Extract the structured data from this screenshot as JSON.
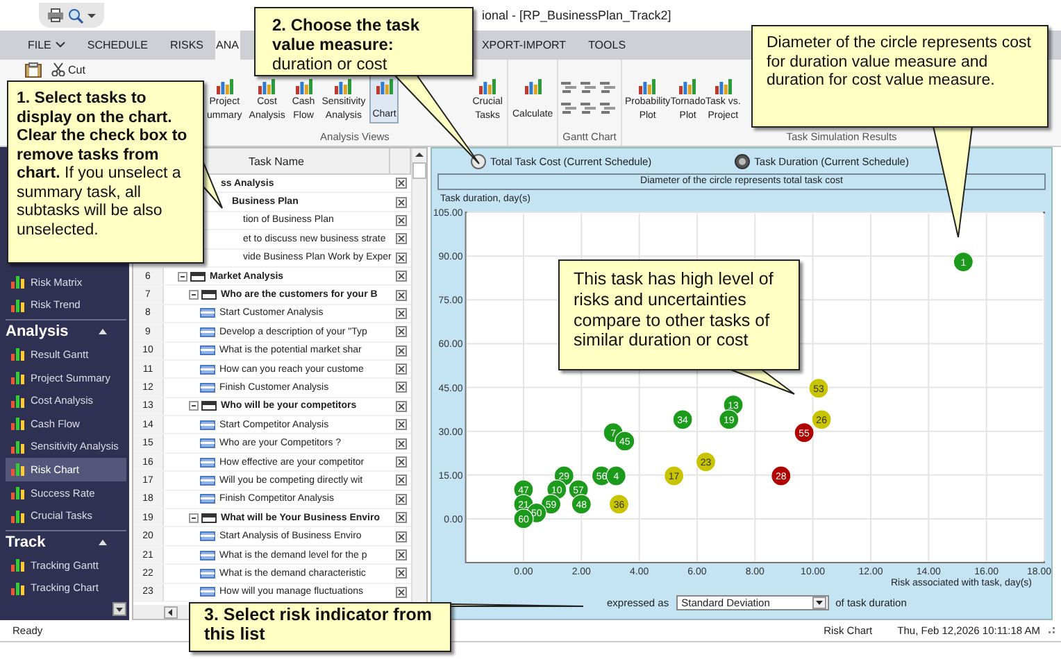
{
  "title_bar": {
    "title": "ional - [RP_BusinessPlan_Track2]"
  },
  "tabs": [
    {
      "label": "FILE",
      "kind": "menu",
      "selected": false
    },
    {
      "label": "SCHEDULE",
      "kind": "tab",
      "selected": false
    },
    {
      "label": "RISKS",
      "kind": "tab",
      "selected": false
    },
    {
      "label": "ANA",
      "kind": "tab",
      "selected": true
    },
    {
      "label": "XPORT-IMPORT",
      "kind": "tab",
      "selected": false
    },
    {
      "label": "TOOLS",
      "kind": "tab",
      "selected": false
    }
  ],
  "ribbon": {
    "clipboard": {
      "cut": "Cut"
    },
    "groups": [
      {
        "label": "Analysis Views",
        "kind": "large",
        "buttons": [
          {
            "lines": [
              "Project",
              "ummary"
            ],
            "selected": false
          },
          {
            "lines": [
              "Cost",
              "Analysis"
            ],
            "selected": false
          },
          {
            "lines": [
              "Cash",
              "Flow"
            ],
            "selected": false
          },
          {
            "lines": [
              "Sensitivity",
              "Analysis"
            ],
            "selected": false
          },
          {
            "lines": [
              "Chart"
            ],
            "selected": true
          },
          {
            "lines": [
              "Crucial",
              "Tasks"
            ],
            "selected": false
          }
        ]
      },
      {
        "kind": "large",
        "buttons": [
          {
            "lines": [
              "Calculate"
            ]
          }
        ]
      },
      {
        "label": "Gantt Chart",
        "kind": "icons"
      },
      {
        "label": "Task Simulation Results",
        "kind": "large",
        "buttons": [
          {
            "lines": [
              "Probability",
              "Plot"
            ]
          },
          {
            "lines": [
              "Tornado",
              "Plot"
            ]
          },
          {
            "lines": [
              "Task vs.",
              "Project"
            ]
          }
        ]
      }
    ]
  },
  "nav": {
    "sections": [
      {
        "items": [
          {
            "label": "Risk Matrix",
            "selected": false
          },
          {
            "label": "Risk Trend",
            "selected": false
          }
        ]
      },
      {
        "title": "Analysis",
        "items": [
          {
            "label": "Result Gantt",
            "selected": false
          },
          {
            "label": "Project Summary",
            "selected": false
          },
          {
            "label": "Cost Analysis",
            "selected": false
          },
          {
            "label": "Cash Flow",
            "selected": false
          },
          {
            "label": "Sensitivity Analysis",
            "selected": false
          },
          {
            "label": "Risk Chart",
            "selected": true
          },
          {
            "label": "Success Rate",
            "selected": false
          },
          {
            "label": "Crucial Tasks",
            "selected": false
          }
        ]
      },
      {
        "title": "Track",
        "items": [
          {
            "label": "Tracking Gantt",
            "selected": false
          },
          {
            "label": "Tracking Chart",
            "selected": false
          }
        ]
      }
    ]
  },
  "grid": {
    "columns": [
      "Task Name"
    ],
    "rows": [
      {
        "name": "ss Analysis",
        "kind": "summary",
        "checked": true,
        "children": [
          {
            "name": "Business Plan",
            "kind": "summary",
            "checked": true,
            "children": [
              {
                "name": "tion of Business Plan",
                "kind": "task",
                "checked": true
              },
              {
                "name": "et to discuss new business strate",
                "kind": "task",
                "checked": true
              },
              {
                "name": "vide Business Plan Work by Exper",
                "kind": "task",
                "checked": true
              }
            ]
          },
          {
            "number": "6",
            "name": "Market Analysis",
            "kind": "summary",
            "checked": true,
            "children": [
              {
                "number": "7",
                "name": "Who are the customers for your B",
                "kind": "summary",
                "checked": true,
                "children": [
                  {
                    "number": "8",
                    "name": "Start Customer Analysis",
                    "kind": "task",
                    "checked": true
                  },
                  {
                    "number": "9",
                    "name": "Develop a description of your \"Typ",
                    "kind": "task",
                    "checked": true
                  },
                  {
                    "number": "10",
                    "name": "What is the potential market shar",
                    "kind": "task",
                    "checked": true
                  },
                  {
                    "number": "11",
                    "name": "How can you reach your custome",
                    "kind": "task",
                    "checked": true
                  },
                  {
                    "number": "12",
                    "name": "Finish Customer Analysis",
                    "kind": "task",
                    "checked": true
                  }
                ]
              },
              {
                "number": "13",
                "name": "Who will be your competitors",
                "kind": "summary",
                "checked": true,
                "children": [
                  {
                    "number": "14",
                    "name": "Start Competitor Analysis",
                    "kind": "task",
                    "checked": true
                  },
                  {
                    "number": "15",
                    "name": "Who are your Competitors ?",
                    "kind": "task",
                    "checked": true
                  },
                  {
                    "number": "16",
                    "name": "How effective are your competitor",
                    "kind": "task",
                    "checked": true
                  },
                  {
                    "number": "17",
                    "name": "Will you be competing directly wit",
                    "kind": "task",
                    "checked": true
                  },
                  {
                    "number": "18",
                    "name": "Finish Competitor Analysis",
                    "kind": "task",
                    "checked": true
                  }
                ]
              },
              {
                "number": "19",
                "name": "What will be Your Business Enviro",
                "kind": "summary",
                "checked": true,
                "children": [
                  {
                    "number": "20",
                    "name": "Start Analysis of Business Enviro",
                    "kind": "task",
                    "checked": true
                  },
                  {
                    "number": "21",
                    "name": "What is the demand level for the p",
                    "kind": "task",
                    "checked": true
                  },
                  {
                    "number": "22",
                    "name": "What is the demand characteristic",
                    "kind": "task",
                    "checked": true
                  },
                  {
                    "number": "23",
                    "name": "How will you manage fluctuations",
                    "kind": "task",
                    "checked": true
                  }
                ]
              }
            ]
          }
        ]
      }
    ]
  },
  "chart": {
    "measure_options": [
      {
        "label": "Total Task Cost (Current Schedule)",
        "selected": false
      },
      {
        "label": "Task Duration (Current Schedule)",
        "selected": true
      }
    ],
    "caption": "Diameter of the circle represents total task cost",
    "chart_data": {
      "type": "scatter",
      "ylabel": "Task duration, day(s)",
      "xlabel": "Risk associated with task, day(s)",
      "xlim": [
        -2,
        18
      ],
      "ylim": [
        -15,
        105
      ],
      "grid": true,
      "xticks": [
        {
          "value": 0,
          "label": "0.00"
        },
        {
          "value": 2,
          "label": "2.00"
        },
        {
          "value": 4,
          "label": "4.00"
        },
        {
          "value": 6,
          "label": "6.00"
        },
        {
          "value": 8,
          "label": "8.00"
        },
        {
          "value": 10,
          "label": "10.00"
        },
        {
          "value": 12,
          "label": "12.00"
        },
        {
          "value": 14,
          "label": "14.00"
        },
        {
          "value": 16,
          "label": "16.00"
        },
        {
          "value": 18,
          "label": "18.00"
        }
      ],
      "yticks": [
        {
          "value": 0,
          "label": "0.00"
        },
        {
          "value": 15,
          "label": "15.00"
        },
        {
          "value": 30,
          "label": "30.00"
        },
        {
          "value": 45,
          "label": "45.00"
        },
        {
          "value": 60,
          "label": "60.00"
        },
        {
          "value": 75,
          "label": "75.00"
        },
        {
          "value": 90,
          "label": "90.00"
        },
        {
          "value": 105,
          "label": "105.00"
        }
      ],
      "series": [
        {
          "color": "#1c9a1c",
          "x": [
            15.2,
            7.25,
            7.1,
            5.5,
            3.1,
            3.5,
            1.4,
            2.7,
            3.2,
            0,
            1.15,
            1.9,
            0,
            0.95,
            2.0,
            0.45,
            0
          ],
          "values": [
            88,
            39,
            34,
            34,
            29.5,
            26.6,
            14.7,
            14.7,
            14.7,
            10,
            10,
            10,
            5,
            5,
            5,
            2,
            0
          ]
        },
        {
          "color": "#c8c400",
          "x": [
            10.2,
            10.3,
            6.3,
            5.2,
            3.3
          ],
          "values": [
            44.7,
            34,
            19.5,
            14.7,
            5
          ]
        },
        {
          "color": "#b00000",
          "x": [
            9.7,
            8.9
          ],
          "values": [
            29.5,
            14.7
          ]
        }
      ],
      "annotations": [
        {
          "x": 15.2,
          "y": 88,
          "text": "1"
        },
        {
          "x": 7.25,
          "y": 39,
          "text": "13"
        },
        {
          "x": 7.1,
          "y": 34,
          "text": "19"
        },
        {
          "x": 5.5,
          "y": 34,
          "text": "34"
        },
        {
          "x": 3.1,
          "y": 29.5,
          "text": "7"
        },
        {
          "x": 3.5,
          "y": 26.6,
          "text": "45"
        },
        {
          "x": 1.4,
          "y": 14.7,
          "text": "29"
        },
        {
          "x": 2.7,
          "y": 14.7,
          "text": "56"
        },
        {
          "x": 3.2,
          "y": 14.7,
          "text": "4"
        },
        {
          "x": 0,
          "y": 10,
          "text": "47"
        },
        {
          "x": 1.15,
          "y": 10,
          "text": "10"
        },
        {
          "x": 1.9,
          "y": 10,
          "text": "57"
        },
        {
          "x": 0,
          "y": 5,
          "text": "21"
        },
        {
          "x": 0.95,
          "y": 5,
          "text": "59"
        },
        {
          "x": 2.0,
          "y": 5,
          "text": "48"
        },
        {
          "x": 0.45,
          "y": 2,
          "text": "50"
        },
        {
          "x": 0,
          "y": 0,
          "text": "60"
        },
        {
          "x": 10.2,
          "y": 44.7,
          "text": "53"
        },
        {
          "x": 10.3,
          "y": 34,
          "text": "26"
        },
        {
          "x": 6.3,
          "y": 19.5,
          "text": "23"
        },
        {
          "x": 5.2,
          "y": 14.7,
          "text": "17"
        },
        {
          "x": 3.3,
          "y": 5,
          "text": "36"
        },
        {
          "x": 9.7,
          "y": 29.5,
          "text": "55"
        },
        {
          "x": 8.9,
          "y": 14.7,
          "text": "28"
        }
      ]
    },
    "risk_label": "expressed as",
    "risk_measure": "Standard Deviation",
    "risk_suffix": "of task duration"
  },
  "status_bar": {
    "left": "Ready",
    "view": "Risk Chart",
    "datetime": "Thu, Feb 12,2026 10:11:18 AM"
  },
  "callouts": [
    {
      "kind": "step",
      "text": "**1. Select tasks to display on the chart. Clear the check box to remove tasks from chart.** If you unselect a summary task, all subtasks will be also unselected."
    },
    {
      "kind": "step",
      "text": "**2. Choose the task value measure:** duration or cost"
    },
    {
      "kind": "note",
      "text": "Diameter of the circle represents cost for duration value measure and duration for cost value measure."
    },
    {
      "kind": "note",
      "text": "This task has high level of risks and uncertainties compare to other tasks of similar duration or cost"
    },
    {
      "kind": "heading",
      "text": "3. Select risk indicator from this list"
    }
  ]
}
